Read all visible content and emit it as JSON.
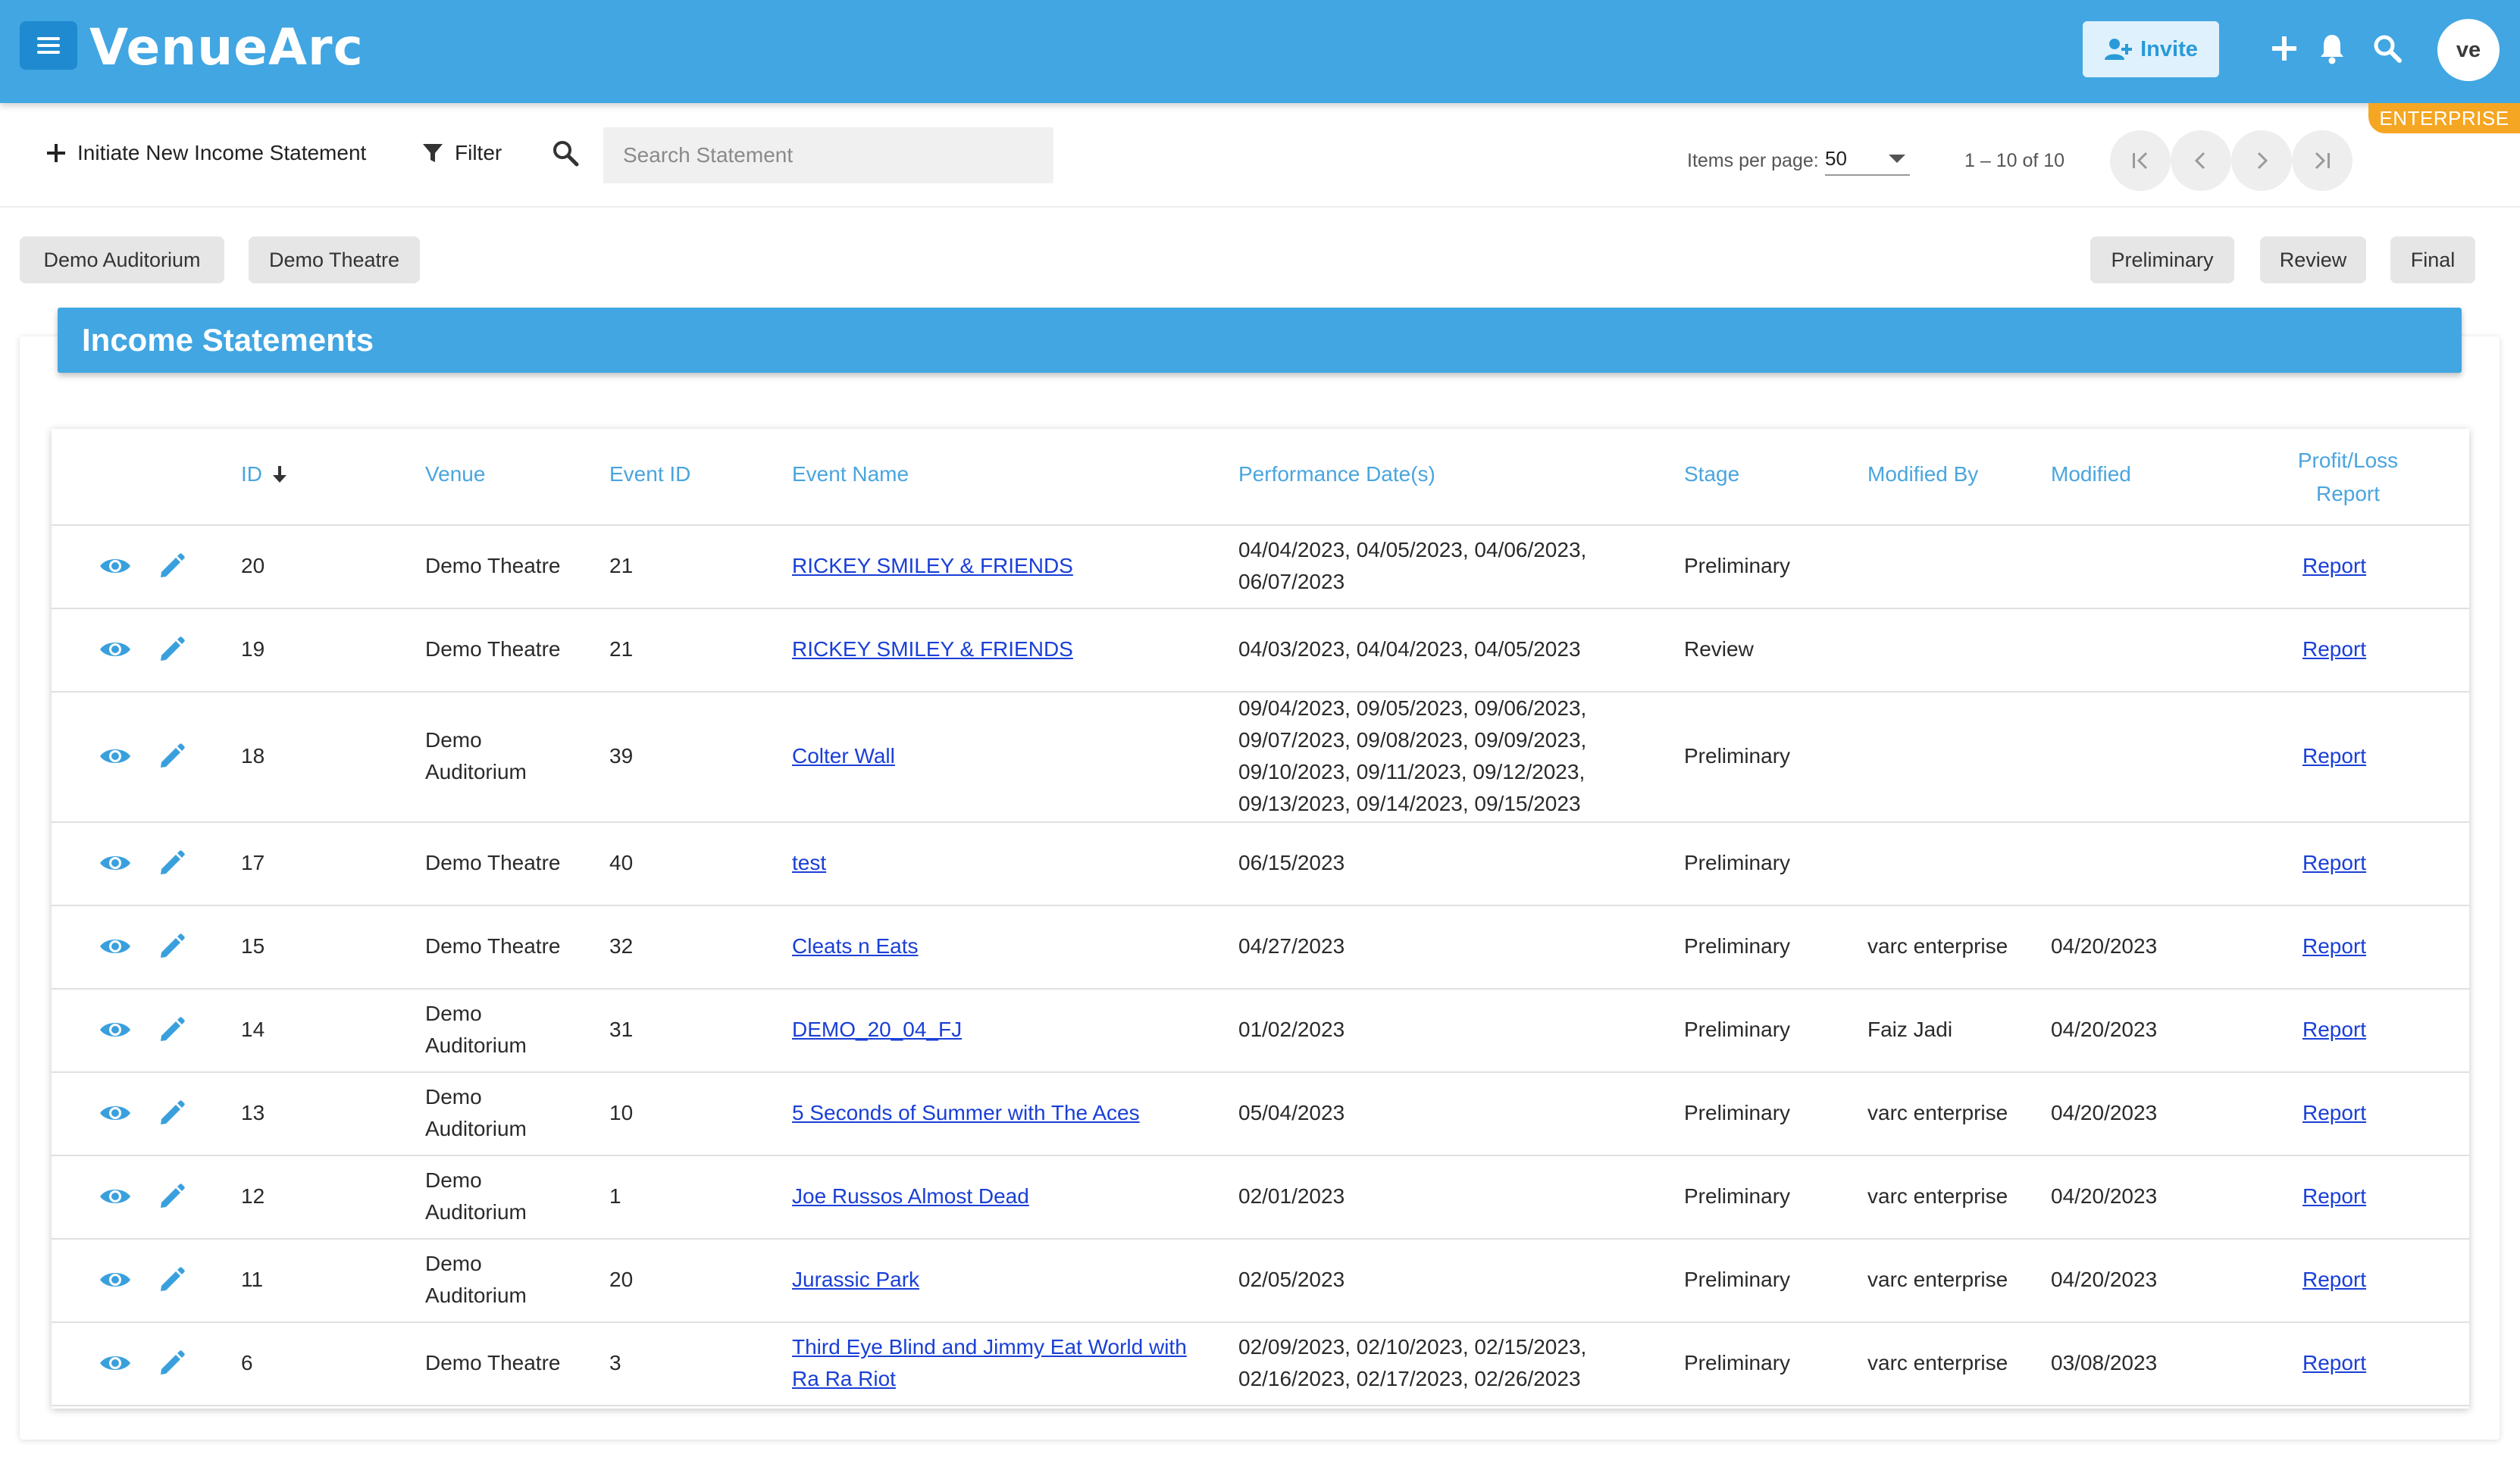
{
  "app": {
    "logo": "VenueArc",
    "invite_label": "Invite",
    "avatar_initials": "ve",
    "plan_badge": "ENTERPRISE",
    "accent_color": "#41a6e2",
    "icons": [
      "menu-icon",
      "add-user-icon",
      "plus-icon",
      "bell-icon",
      "search-icon"
    ]
  },
  "toolbar": {
    "new_label": "Initiate New Income Statement",
    "filter_label": "Filter",
    "search_placeholder": "Search Statement",
    "items_per_page_label": "Items per page:",
    "items_per_page_value": "50",
    "range_label": "1 – 10 of 10"
  },
  "filters": {
    "venues": [
      "Demo Auditorium",
      "Demo Theatre"
    ],
    "stages": [
      "Preliminary",
      "Review",
      "Final"
    ]
  },
  "card": {
    "title": "Income Statements"
  },
  "table": {
    "headers": {
      "id": "ID",
      "venue": "Venue",
      "event_id": "Event ID",
      "event_name": "Event Name",
      "dates": "Performance Date(s)",
      "stage": "Stage",
      "modified_by": "Modified By",
      "modified": "Modified",
      "report_line1": "Profit/Loss",
      "report_line2": "Report"
    },
    "rows": [
      {
        "id": "20",
        "venue": "Demo Theatre",
        "event_id": "21",
        "event_name": "RICKEY SMILEY & FRIENDS",
        "dates": "04/04/2023, 04/05/2023, 04/06/2023, 06/07/2023",
        "stage": "Preliminary",
        "modified_by": "",
        "modified": "",
        "report": "Report"
      },
      {
        "id": "19",
        "venue": "Demo Theatre",
        "event_id": "21",
        "event_name": "RICKEY SMILEY & FRIENDS",
        "dates": "04/03/2023, 04/04/2023, 04/05/2023",
        "stage": "Review",
        "modified_by": "",
        "modified": "",
        "report": "Report"
      },
      {
        "id": "18",
        "venue": "Demo Auditorium",
        "event_id": "39",
        "event_name": "Colter Wall",
        "dates": "09/04/2023, 09/05/2023, 09/06/2023, 09/07/2023, 09/08/2023, 09/09/2023, 09/10/2023, 09/11/2023, 09/12/2023, 09/13/2023, 09/14/2023, 09/15/2023",
        "stage": "Preliminary",
        "modified_by": "",
        "modified": "",
        "report": "Report"
      },
      {
        "id": "17",
        "venue": "Demo Theatre",
        "event_id": "40",
        "event_name": "test",
        "dates": "06/15/2023",
        "stage": "Preliminary",
        "modified_by": "",
        "modified": "",
        "report": "Report"
      },
      {
        "id": "15",
        "venue": "Demo Theatre",
        "event_id": "32",
        "event_name": "Cleats n Eats",
        "dates": "04/27/2023",
        "stage": "Preliminary",
        "modified_by": "varc enterprise",
        "modified": "04/20/2023",
        "report": "Report"
      },
      {
        "id": "14",
        "venue": "Demo Auditorium",
        "event_id": "31",
        "event_name": "DEMO_20_04_FJ",
        "dates": "01/02/2023",
        "stage": "Preliminary",
        "modified_by": "Faiz Jadi",
        "modified": "04/20/2023",
        "report": "Report"
      },
      {
        "id": "13",
        "venue": "Demo Auditorium",
        "event_id": "10",
        "event_name": "5 Seconds of Summer with The Aces",
        "dates": "05/04/2023",
        "stage": "Preliminary",
        "modified_by": "varc enterprise",
        "modified": "04/20/2023",
        "report": "Report"
      },
      {
        "id": "12",
        "venue": "Demo Auditorium",
        "event_id": "1",
        "event_name": "Joe Russos Almost Dead",
        "dates": "02/01/2023",
        "stage": "Preliminary",
        "modified_by": "varc enterprise",
        "modified": "04/20/2023",
        "report": "Report"
      },
      {
        "id": "11",
        "venue": "Demo Auditorium",
        "event_id": "20",
        "event_name": "Jurassic Park",
        "dates": "02/05/2023",
        "stage": "Preliminary",
        "modified_by": "varc enterprise",
        "modified": "04/20/2023",
        "report": "Report"
      },
      {
        "id": "6",
        "venue": "Demo Theatre",
        "event_id": "3",
        "event_name": "Third Eye Blind and Jimmy Eat World with Ra Ra Riot",
        "dates": "02/09/2023, 02/10/2023, 02/15/2023, 02/16/2023, 02/17/2023, 02/26/2023",
        "stage": "Preliminary",
        "modified_by": "varc enterprise",
        "modified": "03/08/2023",
        "report": "Report"
      }
    ]
  }
}
